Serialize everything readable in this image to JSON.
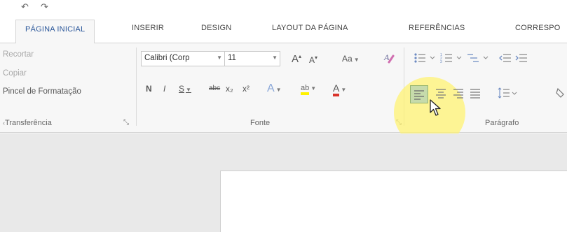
{
  "ribbon_tabs": [
    {
      "label": "PÁGINA INICIAL",
      "active": true
    },
    {
      "label": "INSERIR"
    },
    {
      "label": "DESIGN"
    },
    {
      "label": "LAYOUT DA PÁGINA"
    },
    {
      "label": "REFERÊNCIAS"
    },
    {
      "label": "CORRESPO"
    }
  ],
  "clipboard": {
    "cut_label": "Recortar",
    "copy_label": "Copiar",
    "format_painter_label": "Pincel de Formatação",
    "group_label": "Transferência"
  },
  "font": {
    "font_name": "Calibri (Corp",
    "font_size": "11",
    "grow_label": "A",
    "shrink_label": "A",
    "case_label": "Aa",
    "bold_label": "N",
    "italic_label": "I",
    "underline_label": "S",
    "strike_label": "abc",
    "subscript_label": "x₂",
    "superscript_label": "x²",
    "effects_label": "A",
    "highlight_label": "ab",
    "font_color_label": "A",
    "group_label": "Fonte"
  },
  "paragraph": {
    "group_label": "Parágrafo"
  },
  "colors": {
    "accent": "#2b579a",
    "font_color_red": "#d9342b",
    "highlight_yellow": "#fff200",
    "cursor_highlight": "#fff26e",
    "selected_align": "#c6dbab"
  }
}
